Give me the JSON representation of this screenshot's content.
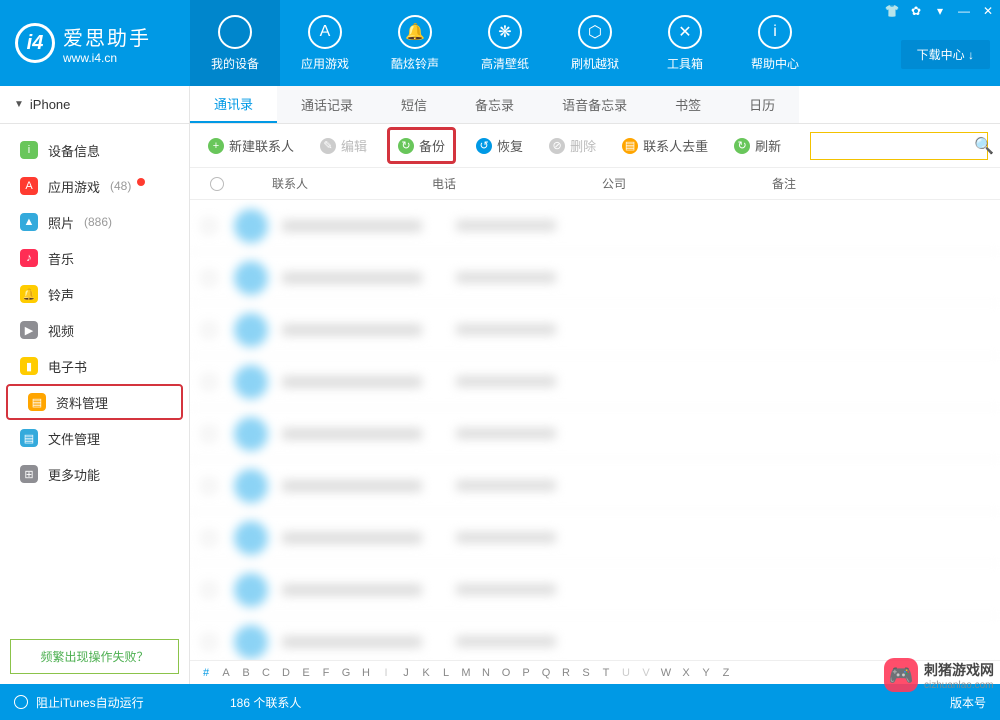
{
  "brand": {
    "name": "爱思助手",
    "url": "www.i4.cn"
  },
  "nav": [
    {
      "label": "我的设备",
      "icon": ""
    },
    {
      "label": "应用游戏",
      "icon": "A"
    },
    {
      "label": "酷炫铃声",
      "icon": "🔔"
    },
    {
      "label": "高清壁纸",
      "icon": "❋"
    },
    {
      "label": "刷机越狱",
      "icon": "⬡"
    },
    {
      "label": "工具箱",
      "icon": "✕"
    },
    {
      "label": "帮助中心",
      "icon": "i"
    }
  ],
  "download_center": "下载中心 ↓",
  "winbtns": {
    "tshirt": "👕",
    "gear": "✿",
    "theme": "▾",
    "min": "—",
    "close": "✕"
  },
  "device": "iPhone",
  "sidebar": [
    {
      "label": "设备信息",
      "ic": "i",
      "bg": "#69c65b",
      "count": "",
      "dot": false
    },
    {
      "label": "应用游戏",
      "ic": "A",
      "bg": "#ff3b30",
      "count": "(48)",
      "dot": true
    },
    {
      "label": "照片",
      "ic": "▲",
      "bg": "#34aadc",
      "count": "(886)",
      "dot": false
    },
    {
      "label": "音乐",
      "ic": "♪",
      "bg": "#ff2d55",
      "count": "",
      "dot": false
    },
    {
      "label": "铃声",
      "ic": "🔔",
      "bg": "#ffcc00",
      "count": "",
      "dot": false
    },
    {
      "label": "视频",
      "ic": "▶",
      "bg": "#8e8e93",
      "count": "",
      "dot": false
    },
    {
      "label": "电子书",
      "ic": "▮",
      "bg": "#ffcc00",
      "count": "",
      "dot": false
    },
    {
      "label": "资料管理",
      "ic": "▤",
      "bg": "#ffa500",
      "count": "",
      "dot": false,
      "hl": true
    },
    {
      "label": "文件管理",
      "ic": "▤",
      "bg": "#34aadc",
      "count": "",
      "dot": false
    },
    {
      "label": "更多功能",
      "ic": "⊞",
      "bg": "#8e8e93",
      "count": "",
      "dot": false
    }
  ],
  "faq": "频繁出现操作失败？",
  "tabs": [
    "通讯录",
    "通话记录",
    "短信",
    "备忘录",
    "语音备忘录",
    "书签",
    "日历"
  ],
  "actions": [
    {
      "label": "新建联系人",
      "ic": "+",
      "bg": "#69c65b",
      "dis": false,
      "hl": false
    },
    {
      "label": "编辑",
      "ic": "✎",
      "bg": "#ccc",
      "dis": true,
      "hl": false
    },
    {
      "label": "备份",
      "ic": "↻",
      "bg": "#69c65b",
      "dis": false,
      "hl": true
    },
    {
      "label": "恢复",
      "ic": "↺",
      "bg": "#0099e5",
      "dis": false,
      "hl": false
    },
    {
      "label": "删除",
      "ic": "⊘",
      "bg": "#ccc",
      "dis": true,
      "hl": false
    },
    {
      "label": "联系人去重",
      "ic": "▤",
      "bg": "#ffa500",
      "dis": false,
      "hl": false
    },
    {
      "label": "刷新",
      "ic": "↻",
      "bg": "#69c65b",
      "dis": false,
      "hl": false
    }
  ],
  "columns": {
    "contact": "联系人",
    "phone": "电话",
    "company": "公司",
    "remark": "备注"
  },
  "alpha": [
    "#",
    "A",
    "B",
    "C",
    "D",
    "E",
    "F",
    "G",
    "H",
    "I",
    "J",
    "K",
    "L",
    "M",
    "N",
    "O",
    "P",
    "Q",
    "R",
    "S",
    "T",
    "U",
    "V",
    "W",
    "X",
    "Y",
    "Z"
  ],
  "footer": {
    "itunes": "阻止iTunes自动运行",
    "count": "186 个联系人",
    "ver": "版本号"
  },
  "wm": {
    "name": "刺猪游戏网",
    "url": "cizhuanlao.com"
  }
}
